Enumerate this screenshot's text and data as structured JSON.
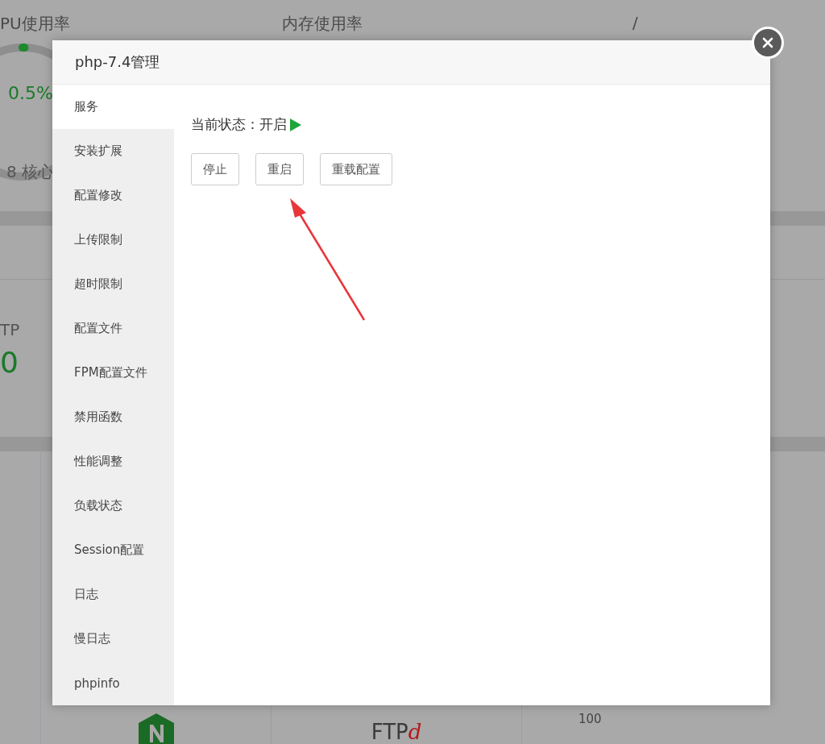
{
  "background": {
    "gauges": [
      {
        "title": "PU使用率",
        "value": "0.5%",
        "level": 0.005,
        "caption": "8 核心"
      },
      {
        "title": "内存使用率"
      },
      {
        "title": "/"
      }
    ],
    "stat": {
      "title": "TP",
      "value": "0"
    },
    "chart_tick": "100",
    "software": [
      {
        "kind": "nginx"
      },
      {
        "kind": "ftpd",
        "label": "FTP",
        "suffix": "d"
      }
    ]
  },
  "dialog": {
    "title": "php-7.4管理",
    "tabs": [
      {
        "label": "服务",
        "selected": true
      },
      {
        "label": "安装扩展",
        "selected": false
      },
      {
        "label": "配置修改",
        "selected": false
      },
      {
        "label": "上传限制",
        "selected": false
      },
      {
        "label": "超时限制",
        "selected": false
      },
      {
        "label": "配置文件",
        "selected": false
      },
      {
        "label": "FPM配置文件",
        "selected": false
      },
      {
        "label": "禁用函数",
        "selected": false
      },
      {
        "label": "性能调整",
        "selected": false
      },
      {
        "label": "负载状态",
        "selected": false
      },
      {
        "label": "Session配置",
        "selected": false
      },
      {
        "label": "日志",
        "selected": false
      },
      {
        "label": "慢日志",
        "selected": false
      },
      {
        "label": "phpinfo",
        "selected": false
      }
    ],
    "status_label": "当前状态：",
    "status": "开启",
    "running": true,
    "buttons": [
      "停止",
      "重启",
      "重载配置"
    ]
  }
}
